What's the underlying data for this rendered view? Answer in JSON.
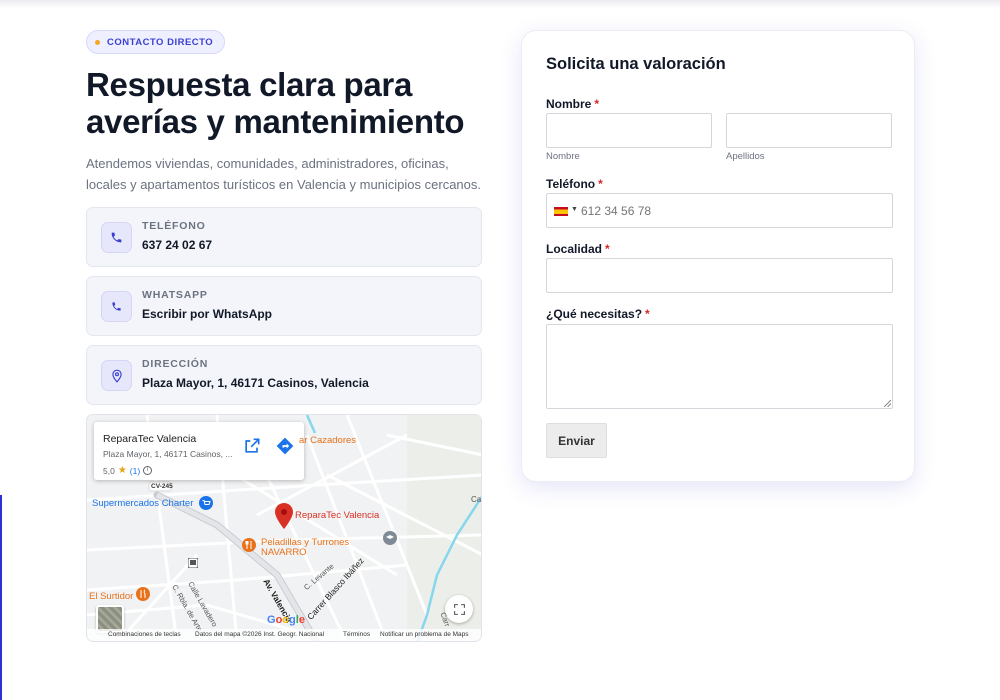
{
  "hero": {
    "badge": "CONTACTO DIRECTO",
    "title_line1": "Respuesta clara para",
    "title_line2": "averías y mantenimiento",
    "subtitle": "Atendemos viviendas, comunidades, administradores, oficinas, locales y apartamentos turísticos en Valencia y municipios cercanos."
  },
  "contacts": [
    {
      "label": "TELÉFONO",
      "value": "637 24 02 67",
      "icon": "phone-icon"
    },
    {
      "label": "WHATSAPP",
      "value": "Escribir por WhatsApp",
      "icon": "whatsapp-phone-icon"
    },
    {
      "label": "DIRECCIÓN",
      "value": "Plaza Mayor, 1, 46171 Casinos, Valencia",
      "icon": "location-pin-icon"
    }
  ],
  "map": {
    "place_name": "ReparaTec Valencia",
    "place_address": "Plaza Mayor, 1, 46171 Casinos, ...",
    "rating": "5,0",
    "rating_count": "(1)",
    "marker_label": "ReparaTec Valencia",
    "poi": {
      "supermarket": "Supermercados Charter",
      "bar": "ar Cazadores",
      "shop_line1": "Peladillas y Turrones",
      "shop_line2": "NAVARRO",
      "restaurant": "El Surtidor",
      "road_badge": "CV-245",
      "edge_label": "Ca"
    },
    "streets": {
      "lavadero": "Calle Lavadero",
      "rbla": "C. Rbla. de Arte",
      "av_valencia": "Av. Valencia",
      "blasco": "Carrer Blasco Ibáñez",
      "levante": "C. Levante",
      "edge": "Carr"
    },
    "footer": {
      "shortcuts": "Combinaciones de teclas",
      "data": "Datos del mapa ©2026 Inst. Geogr. Nacional",
      "terms": "Términos",
      "report": "Notificar un problema de Maps"
    },
    "google_logo": "Google",
    "colors": {
      "marker": "#d93025",
      "poi_orange": "#e8711a",
      "water": "#86d6ee",
      "poi_blue": "#1a73e8"
    }
  },
  "form": {
    "title": "Solicita una valoración",
    "name_label": "Nombre",
    "first_name_sub": "Nombre",
    "last_name_sub": "Apellidos",
    "phone_label": "Teléfono",
    "phone_placeholder": "612 34 56 78",
    "locality_label": "Localidad",
    "needs_label": "¿Qué necesitas?",
    "required_mark": "*",
    "submit_label": "Enviar"
  },
  "colors": {
    "accent": "#3b3fd0",
    "badge_dot": "#f5a623",
    "required": "#d62828"
  }
}
